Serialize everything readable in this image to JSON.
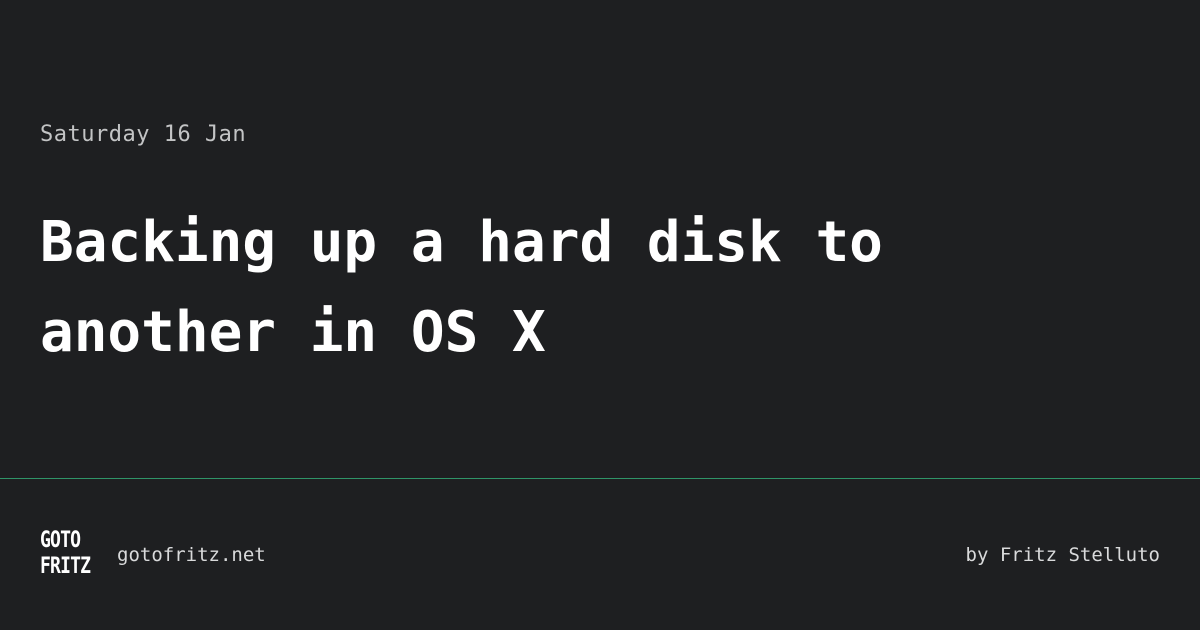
{
  "post": {
    "date": "Saturday 16 Jan",
    "title": "Backing up a hard disk to\nanother in OS X"
  },
  "footer": {
    "logo_line1": "GOTO",
    "logo_line2": "FRITZ",
    "site": "gotofritz.net",
    "author": "by Fritz Stelluto"
  },
  "colors": {
    "background": "#1e1f21",
    "divider": "#2f9468",
    "title": "#ffffff",
    "muted": "#c3c4c5"
  }
}
